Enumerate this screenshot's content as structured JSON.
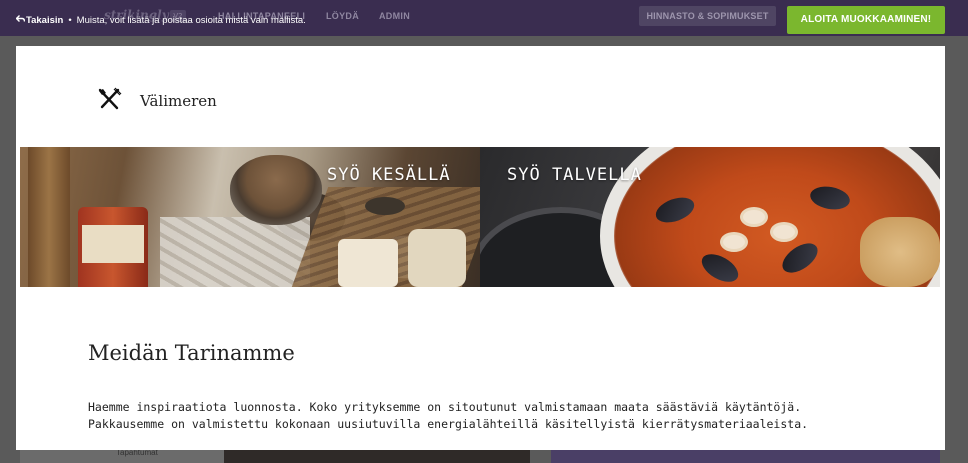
{
  "topbar": {
    "logo": "strikingly",
    "logo_badge": "V2",
    "nav": [
      "HALLINTAPANEELI",
      "LÖYDÄ",
      "ADMIN"
    ],
    "pricing_label": "HINNASTO & SOPIMUKSET",
    "start_label": "ALOITA MUOKKAAMINEN!"
  },
  "notice": {
    "back_label": "Takaisin",
    "separator": "•",
    "message": "Muista, voit lisätä ja poistaa osioita mistä vain mallista."
  },
  "background": {
    "left_caption": "Tapahtumat"
  },
  "preview": {
    "brand_icon": "fork-knife-icon",
    "brand_name": "Välimeren",
    "hero": [
      {
        "caption": "SYÖ KESÄLLÄ"
      },
      {
        "caption": "SYÖ TALVELLA"
      }
    ],
    "story_title": "Meidän Tarinamme",
    "story_lines": [
      "Haemme inspiraatiota luonnosta. Koko yrityksemme on sitoutunut valmistamaan maata säästäviä käytäntöjä.",
      "Pakkausemme on valmistettu kokonaan uusiutuvilla energialähteillä käsitellyistä kierrätysmateriaaleista."
    ]
  },
  "colors": {
    "topbar": "#3a2d50",
    "start_button": "#7bb72e",
    "overlay": "#5a5a5a"
  }
}
